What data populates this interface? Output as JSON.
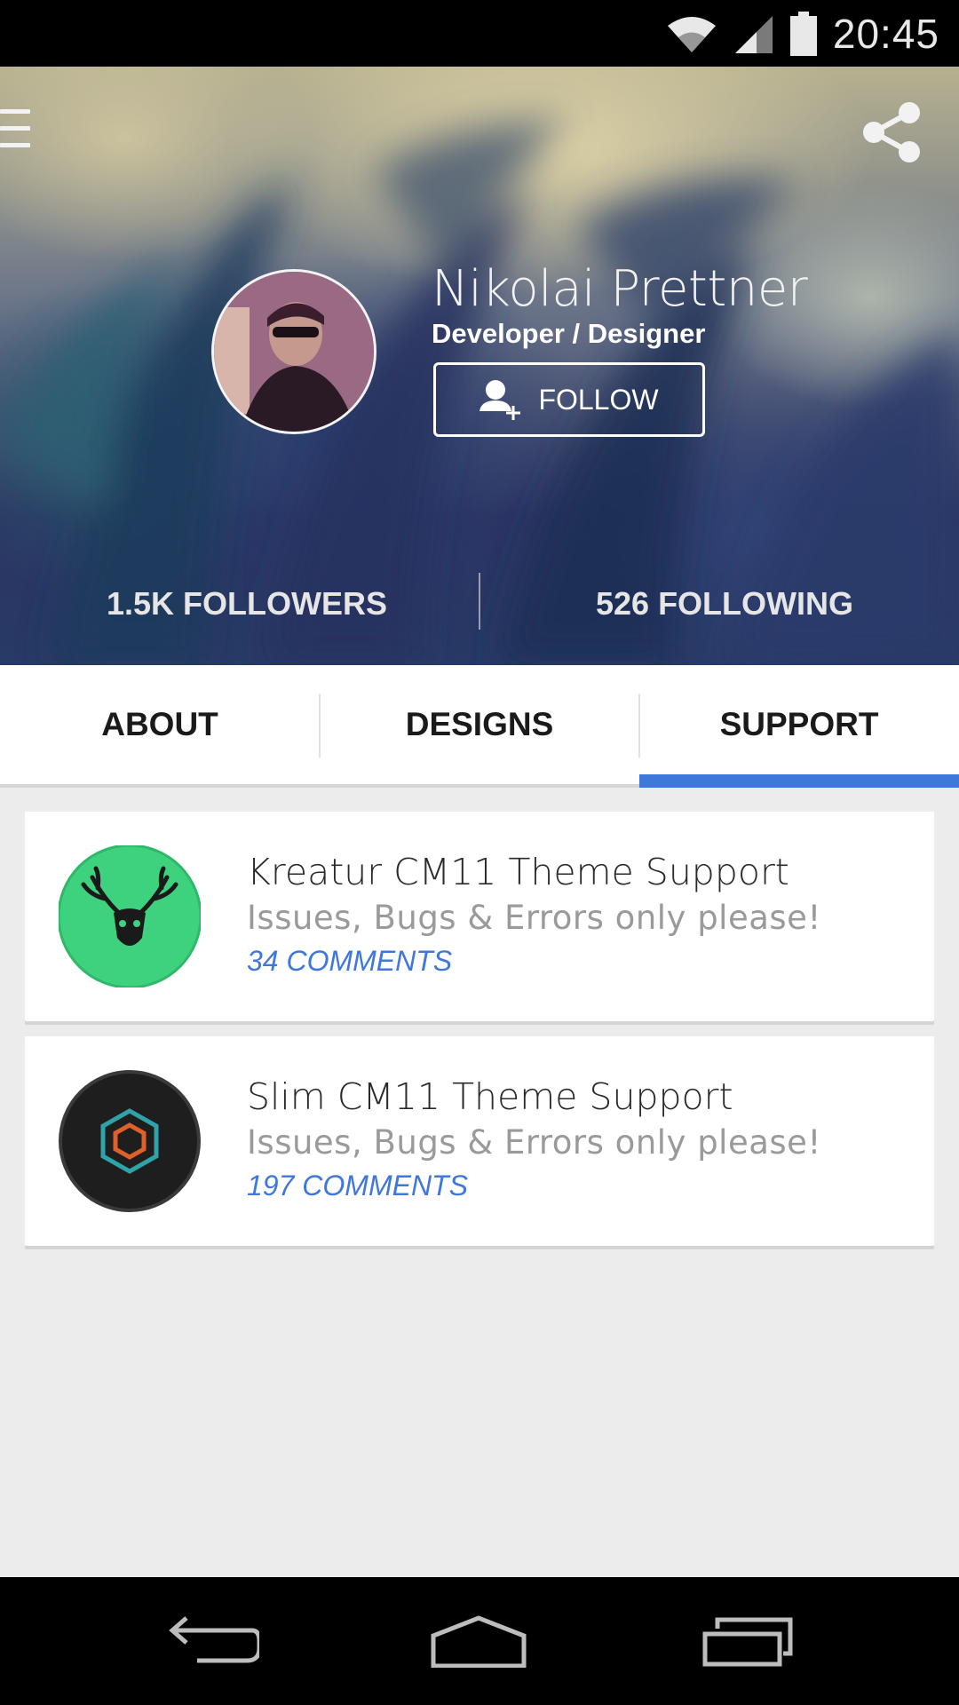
{
  "status_bar": {
    "time": "20:45",
    "icons": [
      "wifi-icon",
      "cell-signal-icon",
      "battery-icon"
    ]
  },
  "header": {
    "menu_icon": "menu-icon",
    "share_icon": "share-icon"
  },
  "profile": {
    "name": "Nikolai Prettner",
    "role": "Developer / Designer",
    "follow_label": "FOLLOW",
    "follow_icon": "add-person-icon",
    "followers": "1.5K FOLLOWERS",
    "following": "526 FOLLOWING"
  },
  "tabs": [
    {
      "label": "ABOUT",
      "active": false
    },
    {
      "label": "DESIGNS",
      "active": false
    },
    {
      "label": "SUPPORT",
      "active": true
    }
  ],
  "accent_color": "#3f77dd",
  "support_items": [
    {
      "title": "Kreatur CM11 Theme Support",
      "subtitle": "Issues, Bugs & Errors only please!",
      "comments": "34 COMMENTS",
      "icon": "deer-skull-icon",
      "icon_color": "#3ed27f"
    },
    {
      "title": "Slim CM11 Theme Support",
      "subtitle": "Issues, Bugs & Errors only please!",
      "comments": "197 COMMENTS",
      "icon": "hexagon-logo-icon",
      "icon_color": "#1e1e1e"
    }
  ],
  "nav_bar": {
    "buttons": [
      "back-icon",
      "home-icon",
      "recents-icon"
    ]
  }
}
